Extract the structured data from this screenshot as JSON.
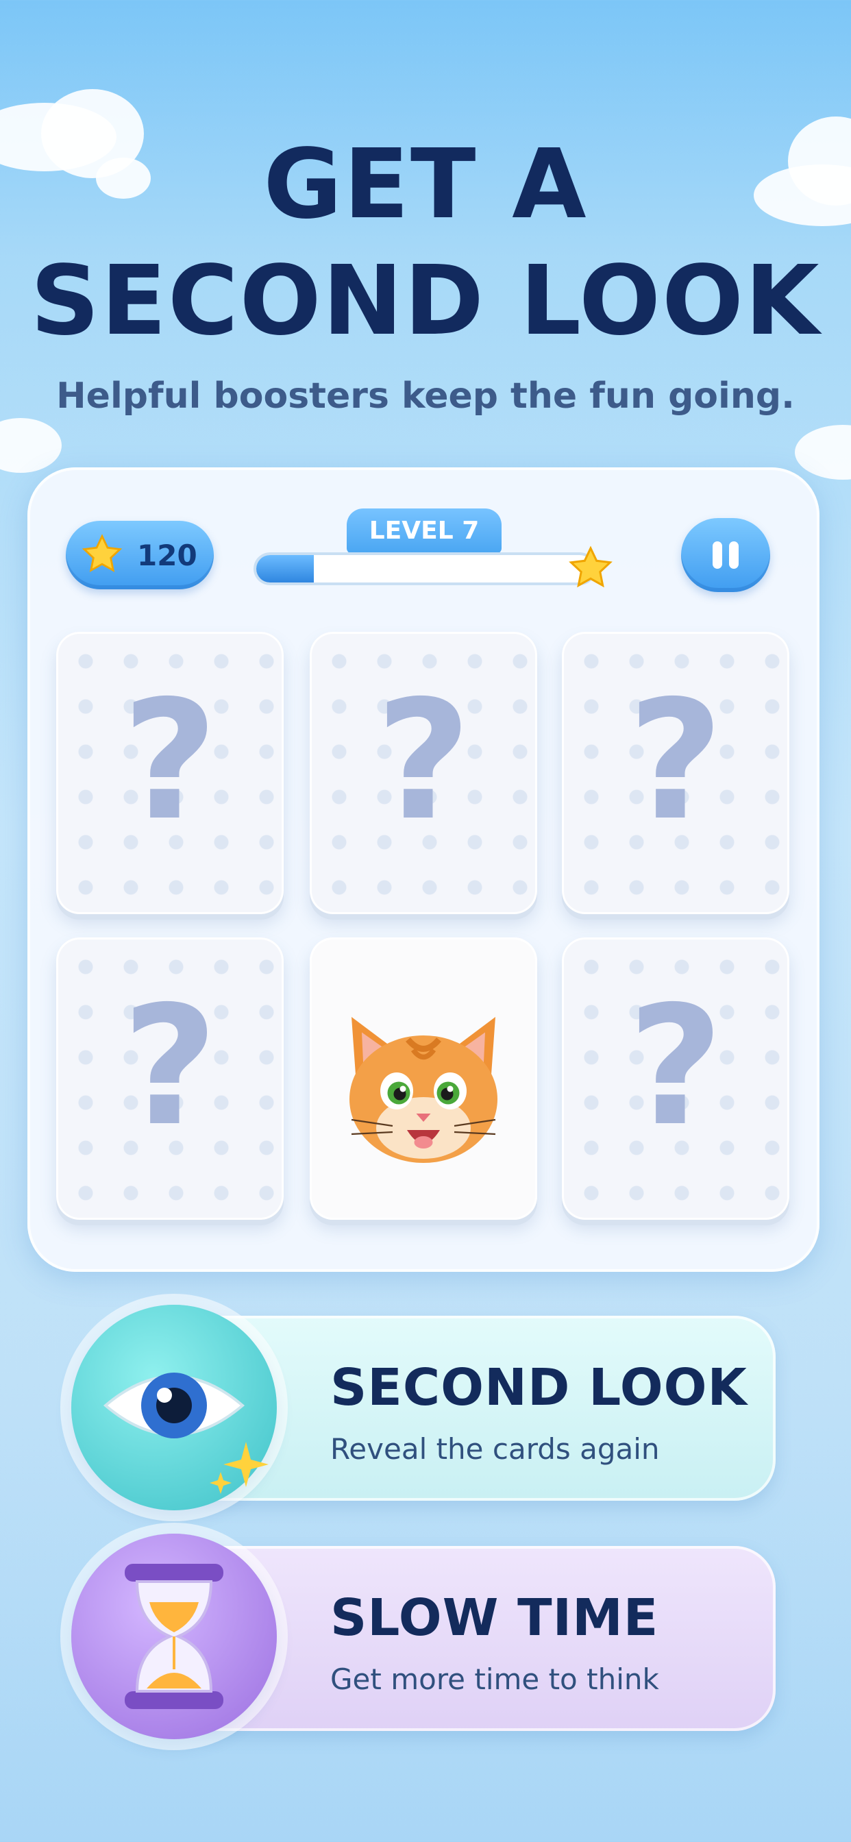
{
  "headline": {
    "line1": "GET A",
    "line2": "SECOND LOOK"
  },
  "subtitle": "Helpful boosters keep the fun going.",
  "hud": {
    "score": "120",
    "level_label": "LEVEL 7",
    "progress_fraction": 0.17
  },
  "cards": [
    {
      "state": "hidden",
      "symbol": "?"
    },
    {
      "state": "hidden",
      "symbol": "?"
    },
    {
      "state": "hidden",
      "symbol": "?"
    },
    {
      "state": "hidden",
      "symbol": "?"
    },
    {
      "state": "revealed",
      "symbol": "cat-face"
    },
    {
      "state": "hidden",
      "symbol": "?"
    }
  ],
  "boosters": {
    "second_look": {
      "title": "SECOND LOOK",
      "desc": "Reveal the cards again",
      "icon": "eye-icon",
      "color": "#5fd3d8"
    },
    "slow_time": {
      "title": "SLOW TIME",
      "desc": "Get more time to think",
      "icon": "hourglass-icon",
      "color": "#b690ec"
    }
  },
  "colors": {
    "headline": "#122a5e",
    "accent_blue": "#3f9cf0",
    "card_mark": "#a7b6da"
  }
}
